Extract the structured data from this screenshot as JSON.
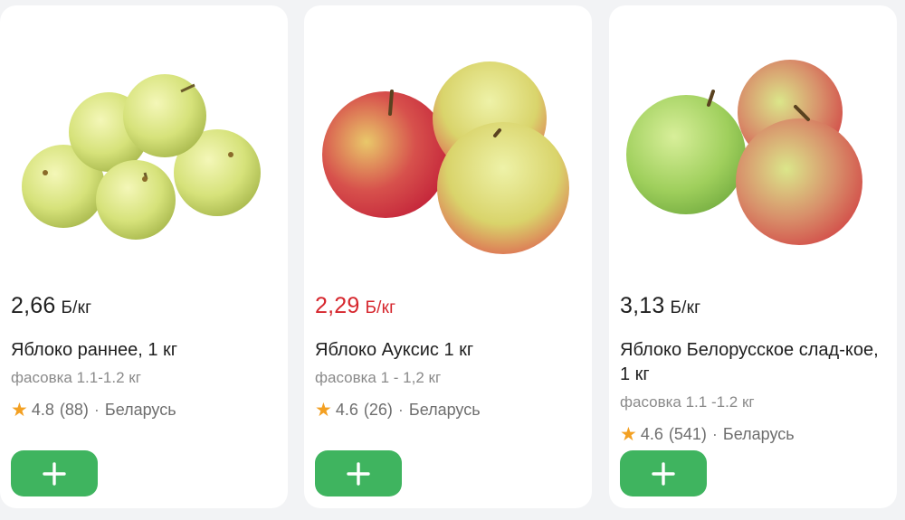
{
  "products": [
    {
      "price": "2,66",
      "unit": "Б/кг",
      "title": "Яблоко раннее, 1 кг",
      "subtitle": "фасовка 1.1-1.2 кг",
      "rating": "4.8",
      "reviews": "(88)",
      "country": "Беларусь"
    },
    {
      "price": "2,29",
      "unit": "Б/кг",
      "title": "Яблоко Ауксис 1 кг",
      "subtitle": "фасовка 1 - 1,2 кг",
      "rating": "4.6",
      "reviews": "(26)",
      "country": "Беларусь",
      "price_color": "#d6262d"
    },
    {
      "price": "3,13",
      "unit": "Б/кг",
      "title": "Яблоко Белорусское слад-кое, 1 кг",
      "subtitle": "фасовка 1.1 -1.2 кг",
      "rating": "4.6",
      "reviews": "(541)",
      "country": "Беларусь"
    }
  ],
  "icons": {
    "rating": "star-icon",
    "add": "plus-icon"
  },
  "colors": {
    "add_button": "#3fb45f",
    "star": "#f3a022",
    "discount_price": "#d6262d"
  }
}
